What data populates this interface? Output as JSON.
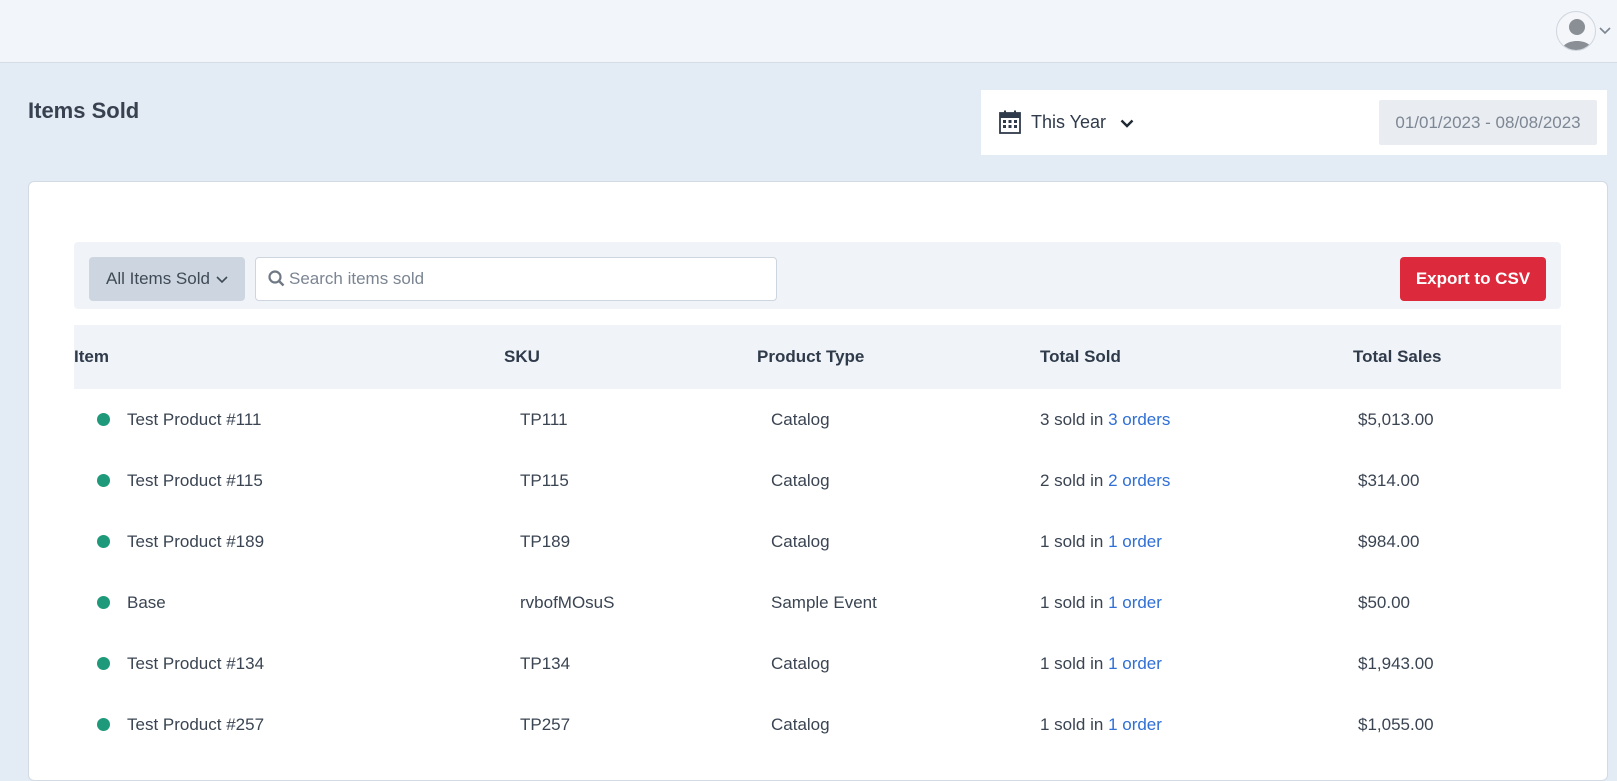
{
  "header": {
    "user_menu": {
      "avatar_icon": "user-avatar-icon",
      "caret_icon": "chevron-down-icon"
    }
  },
  "page": {
    "title": "Items Sold"
  },
  "date_filter": {
    "icon": "calendar-icon",
    "range_label": "This Year",
    "date_range": "01/01/2023 - 08/08/2023"
  },
  "toolbar": {
    "filter_label": "All Items Sold",
    "search_placeholder": "Search items sold",
    "search_value": "",
    "export_label": "Export to CSV"
  },
  "colors": {
    "accent_link": "#2f6fd6",
    "export_button": "#dc2a3c",
    "status_dot": "#1e9a7a"
  },
  "table": {
    "columns": [
      "Item",
      "SKU",
      "Product Type",
      "Total Sold",
      "Total Sales"
    ],
    "rows": [
      {
        "item": "Test Product #111",
        "sku": "TP111",
        "type": "Catalog",
        "sold_text": "3 sold in",
        "orders_link": "3 orders",
        "sales": "$5,013.00"
      },
      {
        "item": "Test Product #115",
        "sku": "TP115",
        "type": "Catalog",
        "sold_text": "2 sold in",
        "orders_link": "2 orders",
        "sales": "$314.00"
      },
      {
        "item": "Test Product #189",
        "sku": "TP189",
        "type": "Catalog",
        "sold_text": "1 sold in",
        "orders_link": "1 order",
        "sales": "$984.00"
      },
      {
        "item": "Base",
        "sku": "rvbofMOsuS",
        "type": "Sample Event",
        "sold_text": "1 sold in",
        "orders_link": "1 order",
        "sales": "$50.00"
      },
      {
        "item": "Test Product #134",
        "sku": "TP134",
        "type": "Catalog",
        "sold_text": "1 sold in",
        "orders_link": "1 order",
        "sales": "$1,943.00"
      },
      {
        "item": "Test Product #257",
        "sku": "TP257",
        "type": "Catalog",
        "sold_text": "1 sold in",
        "orders_link": "1 order",
        "sales": "$1,055.00"
      }
    ]
  }
}
